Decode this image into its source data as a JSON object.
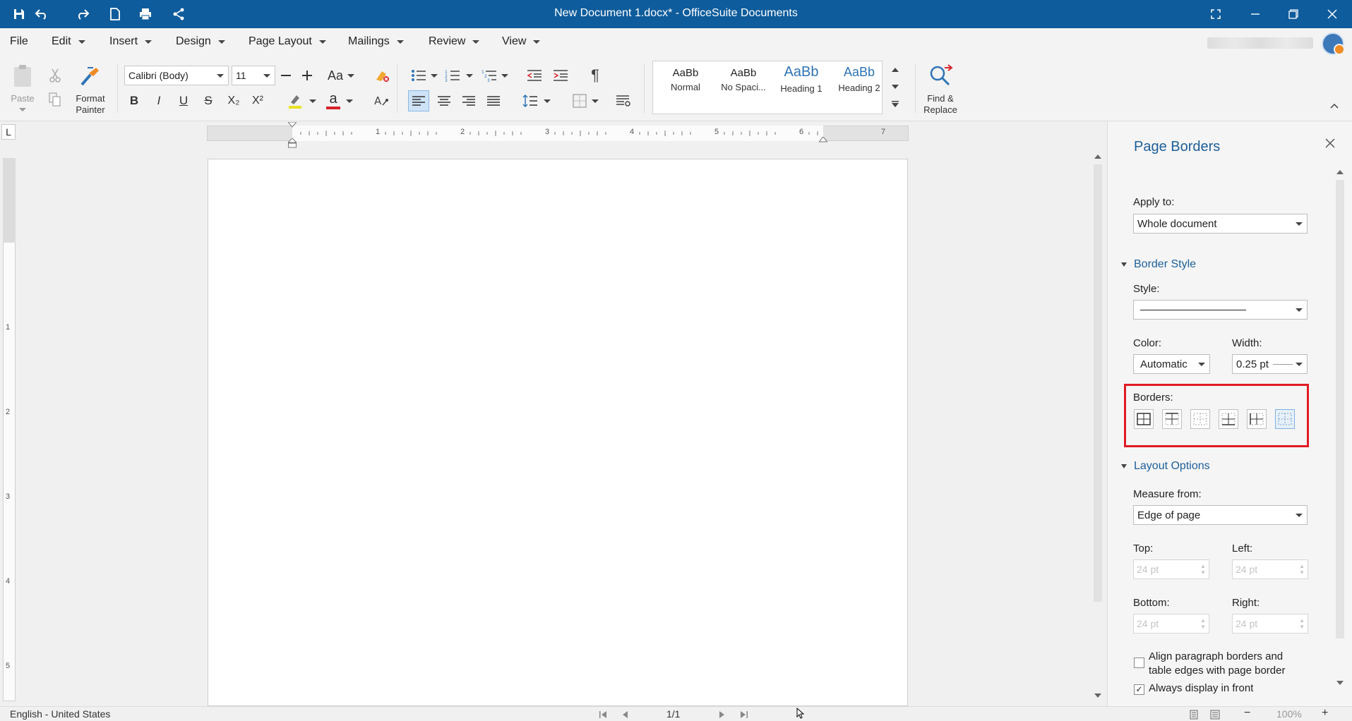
{
  "titlebar": {
    "title": "New Document 1.docx* - OfficeSuite Documents",
    "quick_access": [
      "save-icon",
      "undo-icon",
      "redo-icon",
      "new-doc-icon",
      "print-icon",
      "share-icon"
    ],
    "window_controls": [
      "fullscreen-icon",
      "minimize-icon",
      "restore-icon",
      "close-icon"
    ],
    "bg_color": "#0e5c9c"
  },
  "menubar": {
    "items": [
      "File",
      "Edit",
      "Insert",
      "Design",
      "Page Layout",
      "Mailings",
      "Review",
      "View"
    ]
  },
  "ribbon": {
    "paste_label": "Paste",
    "format_painter_label": "Format Painter",
    "format_painter_line1": "Format",
    "format_painter_line2": "Painter",
    "font_name": "Calibri (Body)",
    "font_size": "11",
    "change_case": "Aa",
    "bold": "B",
    "italic": "I",
    "underline": "U",
    "strike": "S",
    "subscript": "X₂",
    "superscript": "X²",
    "font_color_letter": "a",
    "pilcrow": "¶",
    "styles": [
      {
        "sample": "AaBb",
        "label": "Normal"
      },
      {
        "sample": "AaBb",
        "label": "No Spaci..."
      },
      {
        "sample": "AaBb",
        "label": "Heading 1"
      },
      {
        "sample": "AaBb",
        "label": "Heading 2"
      }
    ],
    "find_replace_line1": "Find &",
    "find_replace_line2": "Replace"
  },
  "ruler": {
    "h_numbers": [
      "1",
      "2",
      "3",
      "4",
      "5",
      "6",
      "7"
    ],
    "v_numbers": [
      "1",
      "2",
      "3",
      "4",
      "5"
    ],
    "tab_selector": "L"
  },
  "panel": {
    "title": "Page Borders",
    "apply_to_label": "Apply to:",
    "apply_to_value": "Whole document",
    "border_style_section": "Border Style",
    "style_label": "Style:",
    "color_label": "Color:",
    "color_value": "Automatic",
    "width_label": "Width:",
    "width_value": "0.25 pt",
    "borders_label": "Borders:",
    "layout_section": "Layout Options",
    "measure_from_label": "Measure from:",
    "measure_from_value": "Edge of page",
    "top_label": "Top:",
    "top_value": "24 pt",
    "left_label": "Left:",
    "left_value": "24 pt",
    "bottom_label": "Bottom:",
    "bottom_value": "24 pt",
    "right_label": "Right:",
    "right_value": "24 pt",
    "align_line1": "Align paragraph borders and",
    "align_line2": "table edges with page border",
    "align_checked": false,
    "always_front": "Always display in front",
    "always_front_checked": true,
    "highlight_color": "#e21b24"
  },
  "statusbar": {
    "language": "English - United States",
    "page_counter": "1/1",
    "zoom": "100%"
  }
}
